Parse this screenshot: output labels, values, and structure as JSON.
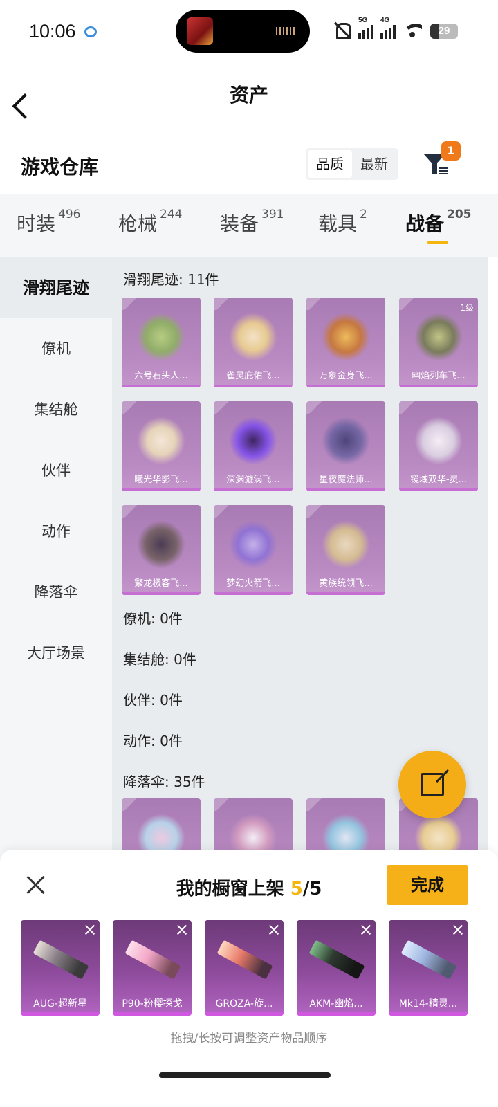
{
  "status_bar": {
    "time": "10:06",
    "signal1": "5G",
    "signal2": "4G",
    "battery": "29"
  },
  "header": {
    "title": "资产"
  },
  "section": {
    "title": "游戏仓库",
    "sort_options": [
      "品质",
      "最新"
    ],
    "filter_badge": "1"
  },
  "tabs": [
    {
      "label": "时装",
      "count": "496"
    },
    {
      "label": "枪械",
      "count": "244"
    },
    {
      "label": "装备",
      "count": "391"
    },
    {
      "label": "载具",
      "count": "2"
    },
    {
      "label": "战备",
      "count": "205"
    }
  ],
  "sidebar": [
    "滑翔尾迹",
    "僚机",
    "集结舱",
    "伙伴",
    "动作",
    "降落伞",
    "大厅场景"
  ],
  "groups": {
    "trails_title": "滑翔尾迹: 11件",
    "wingman_title": "僚机: 0件",
    "pod_title": "集结舱: 0件",
    "partner_title": "伙伴: 0件",
    "emote_title": "动作: 0件",
    "parachute_title": "降落伞: 35件"
  },
  "trail_items": [
    "六号石头人...",
    "雀灵庇佑飞...",
    "万象金身飞...",
    "幽焰列车飞...",
    "曦光华影飞...",
    "深渊漩涡飞...",
    "星夜魔法师...",
    "镜域双华-灵...",
    "繁龙极客飞...",
    "梦幻火箭飞...",
    "黄族统领飞..."
  ],
  "trail_level_badge": "1级",
  "sheet": {
    "title_prefix": "我的橱窗上架 ",
    "count_current": "5",
    "count_total": "/5",
    "done_label": "完成",
    "weapons": [
      "AUG-超新星",
      "P90-粉樱探戈",
      "GROZA-旋...",
      "AKM-幽焰...",
      "Mk14-精灵..."
    ],
    "hint": "拖拽/长按可调整资产物品顺序"
  },
  "colors": {
    "accent": "#f5b117",
    "card_purple": "#b98ac2",
    "weapon_purple": "#8e4b9c"
  }
}
